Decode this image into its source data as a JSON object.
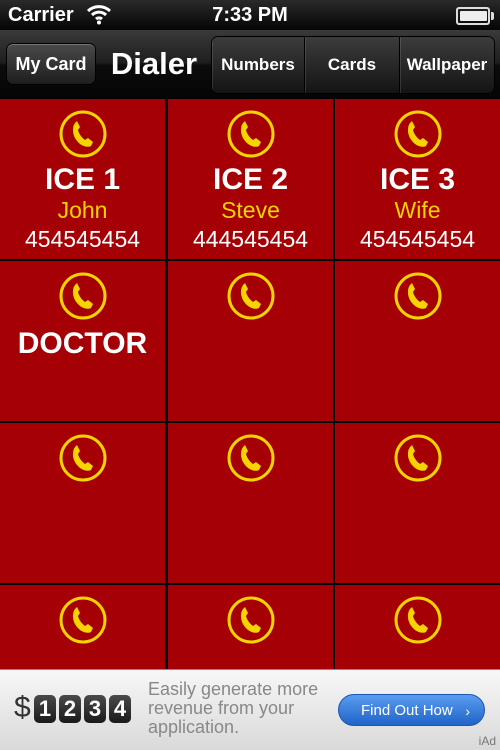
{
  "status_bar": {
    "carrier": "Carrier",
    "time": "7:33 PM"
  },
  "nav": {
    "my_card_label": "My Card",
    "title": "Dialer",
    "segments": [
      "Numbers",
      "Cards",
      "Wallpaper"
    ]
  },
  "cards": [
    {
      "label": "ICE 1",
      "name": "John",
      "number": "454545454"
    },
    {
      "label": "ICE 2",
      "name": "Steve",
      "number": "444545454"
    },
    {
      "label": "ICE 3",
      "name": "Wife",
      "number": "454545454"
    },
    {
      "label": "DOCTOR",
      "name": "",
      "number": ""
    },
    {
      "label": "",
      "name": "",
      "number": ""
    },
    {
      "label": "",
      "name": "",
      "number": ""
    },
    {
      "label": "",
      "name": "",
      "number": ""
    },
    {
      "label": "",
      "name": "",
      "number": ""
    },
    {
      "label": "",
      "name": "",
      "number": ""
    },
    {
      "label": "",
      "name": "",
      "number": ""
    },
    {
      "label": "",
      "name": "",
      "number": ""
    },
    {
      "label": "",
      "name": "",
      "number": ""
    }
  ],
  "icons": {
    "card": "phone-icon",
    "wifi": "wifi-icon",
    "battery": "battery-icon"
  },
  "colors": {
    "card_bg": "#a50005",
    "name_text": "#f5d400",
    "icon": "#f5d400"
  },
  "ad": {
    "currency": "$",
    "digits": [
      "1",
      "2",
      "3",
      "4"
    ],
    "text": "Easily generate more revenue from your application.",
    "button_label": "Find Out How",
    "badge": "iAd"
  }
}
